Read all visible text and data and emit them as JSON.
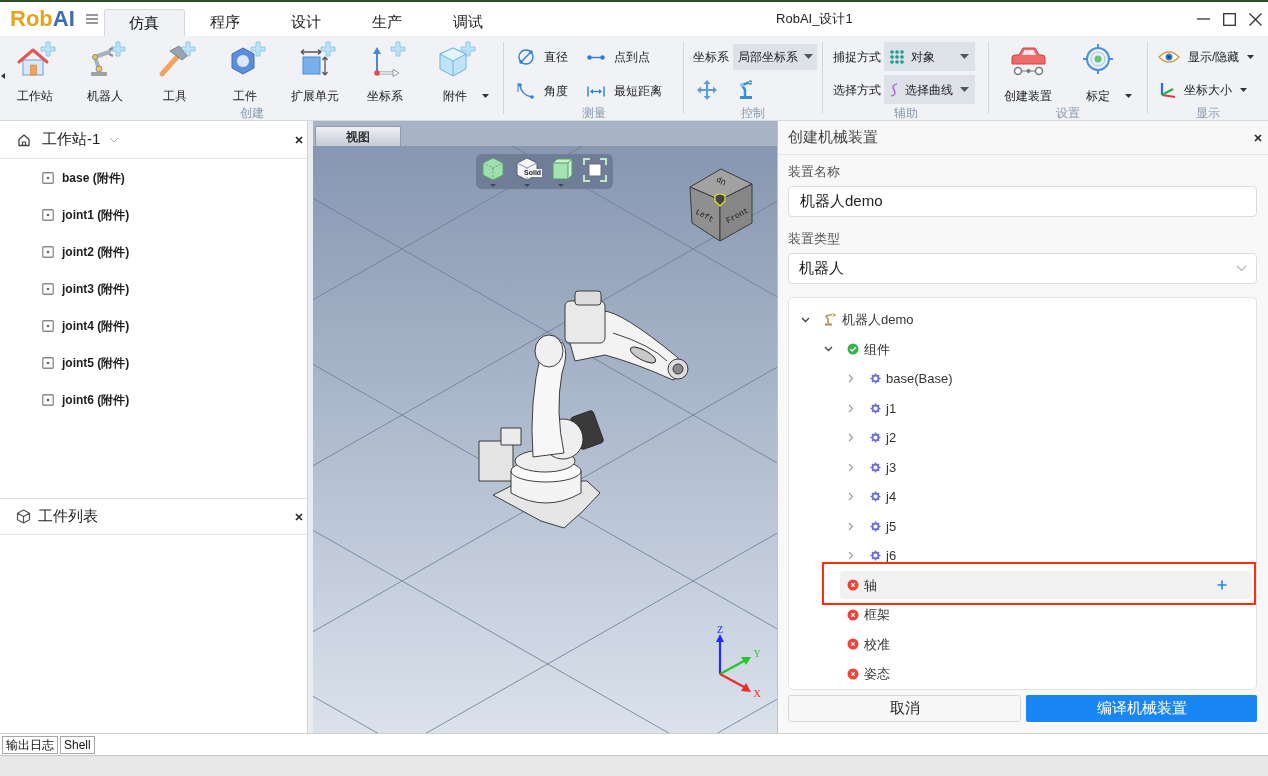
{
  "app": {
    "logo": [
      {
        "text": "Rob",
        "color": "#e9a21c"
      },
      {
        "text": "AI",
        "color": "#3c6db6"
      }
    ],
    "title": "RobAI_设计1"
  },
  "menu_tabs": [
    {
      "label": "仿真",
      "selected": true
    },
    {
      "label": "程序",
      "selected": false
    },
    {
      "label": "设计",
      "selected": false
    },
    {
      "label": "生产",
      "selected": false
    },
    {
      "label": "调试",
      "selected": false
    }
  ],
  "ribbon": [
    {
      "kind": "large",
      "label": "创建",
      "items": [
        {
          "label": "工作站",
          "dropdown": false
        },
        {
          "label": "机器人",
          "dropdown": false
        },
        {
          "label": "工具",
          "dropdown": false
        },
        {
          "label": "工件",
          "dropdown": false
        },
        {
          "label": "扩展单元",
          "dropdown": false
        },
        {
          "label": "坐标系",
          "dropdown": false
        },
        {
          "label": "附件",
          "dropdown": true
        }
      ]
    },
    {
      "kind": "small",
      "label": "测量",
      "items": [
        {
          "label": "直径"
        },
        {
          "label": "点到点"
        },
        {
          "label": "角度"
        },
        {
          "label": "最短距离"
        }
      ]
    },
    {
      "kind": "control",
      "label": "控制",
      "field": {
        "label": "坐标系",
        "value": "局部坐标系"
      }
    },
    {
      "kind": "fields",
      "label": "辅助",
      "fields": [
        {
          "label": "捕捉方式",
          "value": "对象"
        },
        {
          "label": "选择方式",
          "value": "选择曲线"
        }
      ]
    },
    {
      "kind": "large",
      "label": "设置",
      "items": [
        {
          "label": "创建装置",
          "dropdown": false
        },
        {
          "label": "标定",
          "dropdown": true
        }
      ]
    },
    {
      "kind": "menu",
      "label": "显示",
      "items": [
        {
          "label": "显示/隐藏",
          "dropdown": true
        },
        {
          "label": "坐标大小",
          "dropdown": true
        }
      ]
    }
  ],
  "workstation_panel": {
    "title": "工作站-1",
    "items": [
      "base (附件)",
      "joint1 (附件)",
      "joint2 (附件)",
      "joint3 (附件)",
      "joint4 (附件)",
      "joint5 (附件)",
      "joint6 (附件)"
    ]
  },
  "parts_panel": {
    "title": "工件列表"
  },
  "viewport": {
    "tab": "视图",
    "view_mode_label": "Solid",
    "view_cube": [
      "Up",
      "Left",
      "Front"
    ],
    "axes": [
      "Z",
      "Y",
      "X"
    ]
  },
  "device_panel": {
    "title": "创建机械装置",
    "name_label": "装置名称",
    "name_value": "机器人demo",
    "type_label": "装置类型",
    "type_value": "机器人",
    "tree": [
      {
        "kind": "robot",
        "label": "机器人demo",
        "expanded": true,
        "selected": false,
        "annotated": false,
        "children": [
          {
            "kind": "group",
            "label": "组件",
            "complete": true,
            "expanded": true,
            "selected": false,
            "annotated": false,
            "children": [
              {
                "kind": "part",
                "label": "base(Base)",
                "expanded": false,
                "selected": false,
                "annotated": false
              },
              {
                "kind": "part",
                "label": "j1",
                "expanded": false,
                "selected": false,
                "annotated": false
              },
              {
                "kind": "part",
                "label": "j2",
                "expanded": false,
                "selected": false,
                "annotated": false
              },
              {
                "kind": "part",
                "label": "j3",
                "expanded": false,
                "selected": false,
                "annotated": false
              },
              {
                "kind": "part",
                "label": "j4",
                "expanded": false,
                "selected": false,
                "annotated": false
              },
              {
                "kind": "part",
                "label": "j5",
                "expanded": false,
                "selected": false,
                "annotated": false
              },
              {
                "kind": "part",
                "label": "j6",
                "expanded": false,
                "selected": false,
                "annotated": false
              }
            ]
          },
          {
            "kind": "group",
            "label": "轴",
            "complete": false,
            "selected": true,
            "annotated": true
          },
          {
            "kind": "group",
            "label": "框架",
            "complete": false,
            "selected": false,
            "annotated": false
          },
          {
            "kind": "group",
            "label": "校准",
            "complete": false,
            "selected": false,
            "annotated": false
          },
          {
            "kind": "group",
            "label": "姿态",
            "complete": false,
            "selected": false,
            "annotated": false
          }
        ]
      }
    ],
    "cancel": "取消",
    "submit": "编译机械装置"
  },
  "bottom_tabs": [
    "输出日志",
    "Shell"
  ]
}
